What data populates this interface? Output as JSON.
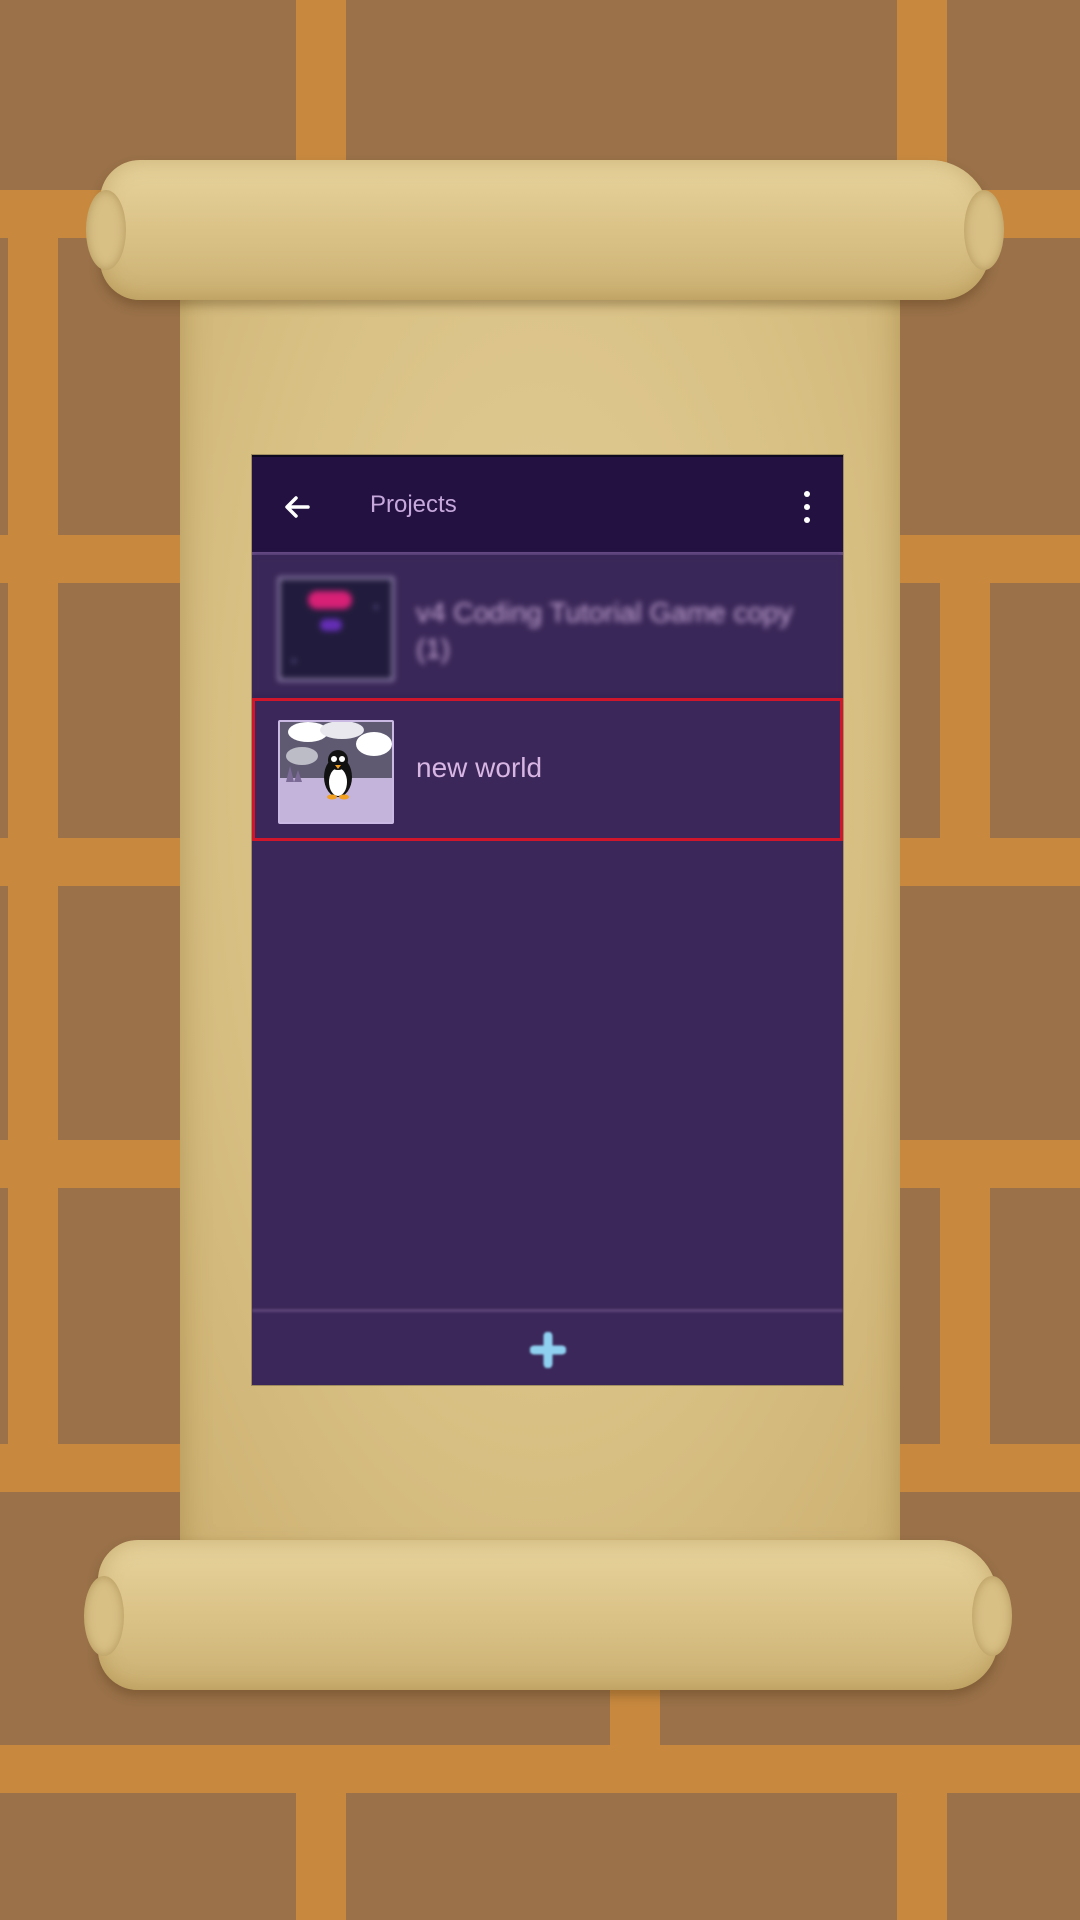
{
  "header": {
    "title": "Projects",
    "back_icon": "arrow-left-icon",
    "menu_icon": "more-vertical-icon"
  },
  "projects": [
    {
      "name": "v4 Coding Tutorial Game copy (1)",
      "thumbnail_icon": "game-thumbnail-icon"
    },
    {
      "name": "new world",
      "thumbnail_icon": "penguin-thumbnail-icon"
    }
  ],
  "footer": {
    "add_icon": "plus-icon"
  },
  "colors": {
    "appbar": "#221141",
    "list_background": "#3b2759",
    "title_text": "#c7a8dc",
    "row_text": "#d8b6e4",
    "selection_outline": "#d0162a",
    "add_accent": "#8fd0f0"
  }
}
